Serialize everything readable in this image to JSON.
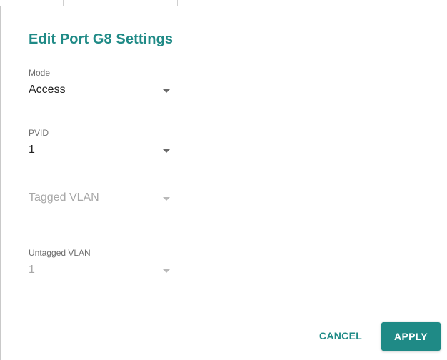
{
  "dialog": {
    "title": "Edit Port G8 Settings"
  },
  "fields": {
    "mode": {
      "label": "Mode",
      "value": "Access",
      "enabled": true
    },
    "pvid": {
      "label": "PVID",
      "value": "1",
      "enabled": true
    },
    "tagged_vlan": {
      "label": "",
      "value": "Tagged VLAN",
      "enabled": false
    },
    "untagged_vlan": {
      "label": "Untagged VLAN",
      "value": "1",
      "enabled": false
    }
  },
  "actions": {
    "cancel_label": "CANCEL",
    "apply_label": "APPLY"
  },
  "colors": {
    "accent": "#1f8a86",
    "text_primary": "#222222",
    "text_disabled": "#a7a7a7",
    "label": "#6f6f6f"
  },
  "icons": {
    "dropdown": "caret-down-icon"
  }
}
